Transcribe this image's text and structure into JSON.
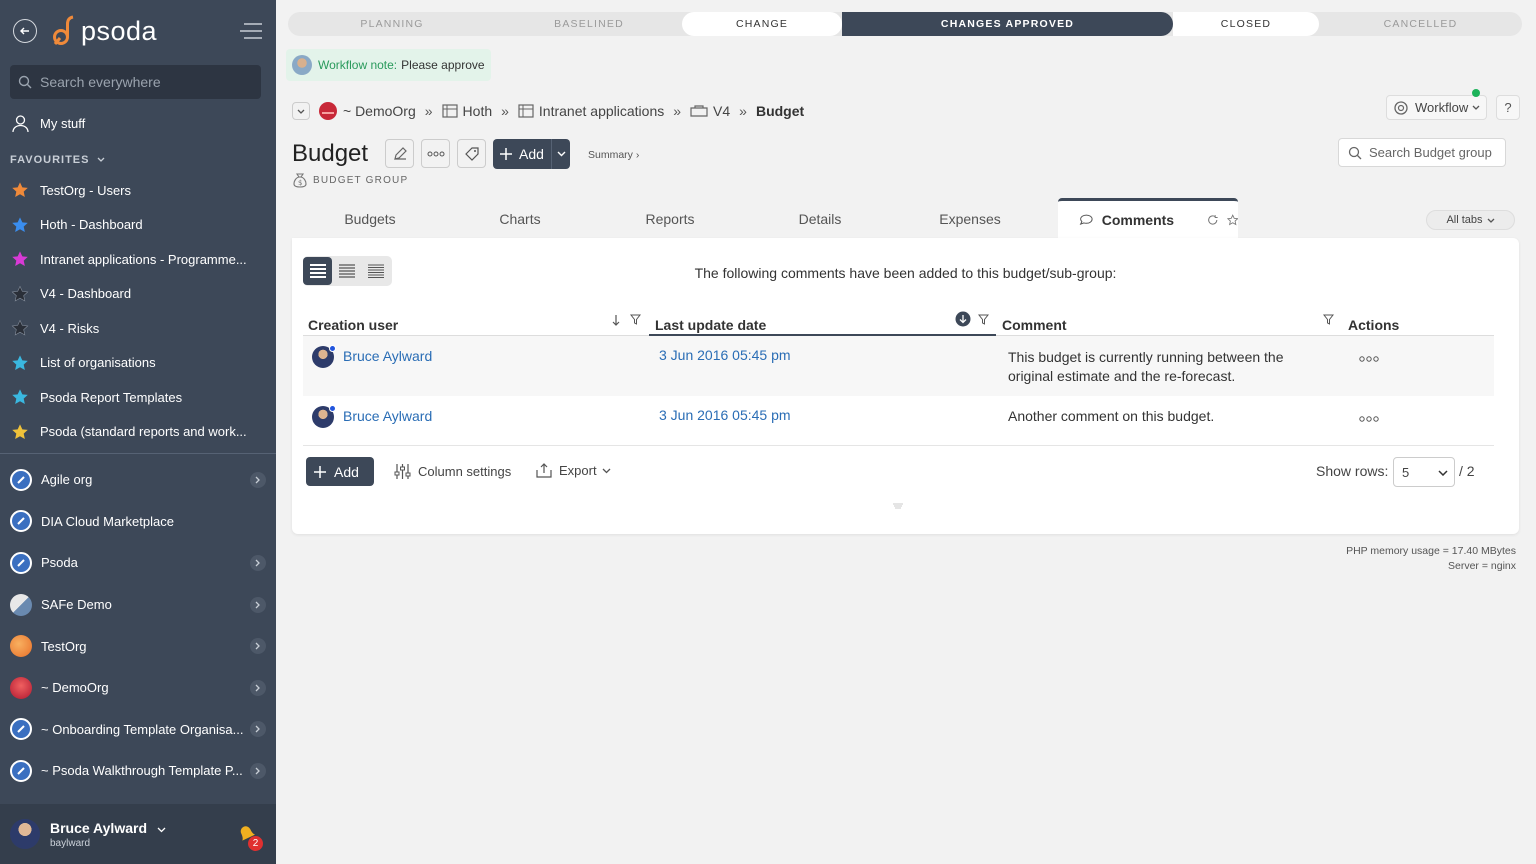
{
  "sidebar": {
    "logo_text": "psoda",
    "search_placeholder": "Search everywhere",
    "my_stuff": "My stuff",
    "favourites_label": "FAVOURITES",
    "favourites": [
      {
        "label": "TestOrg - Users",
        "color": "#f08a3a"
      },
      {
        "label": "Hoth - Dashboard",
        "color": "#3a8ef0"
      },
      {
        "label": "Intranet applications - Programme...",
        "color": "#d93ad6"
      },
      {
        "label": "V4 - Dashboard",
        "color": "#2a2f38"
      },
      {
        "label": "V4 - Risks",
        "color": "#2a2f38"
      },
      {
        "label": "List of organisations",
        "color": "#3ab8e0"
      },
      {
        "label": "Psoda Report Templates",
        "color": "#3ab8e0"
      },
      {
        "label": "Psoda (standard reports and work...",
        "color": "#f0c23a"
      }
    ],
    "orgs": [
      {
        "label": "Agile org",
        "chevron": true
      },
      {
        "label": "DIA Cloud Marketplace",
        "chevron": false
      },
      {
        "label": "Psoda",
        "chevron": true
      },
      {
        "label": "SAFe Demo",
        "chevron": true
      },
      {
        "label": "TestOrg",
        "chevron": true
      },
      {
        "label": "~ DemoOrg",
        "chevron": true
      },
      {
        "label": "~ Onboarding Template Organisa...",
        "chevron": true
      },
      {
        "label": "~ Psoda Walkthrough Template P...",
        "chevron": true
      }
    ],
    "user": {
      "name": "Bruce Aylward",
      "login": "baylward",
      "notifications": "2"
    }
  },
  "stages": [
    "PLANNING",
    "BASELINED",
    "CHANGE",
    "CHANGES APPROVED",
    "CLOSED",
    "CANCELLED"
  ],
  "workflow_note": {
    "label": "Workflow note:",
    "text": "Please approve"
  },
  "breadcrumb": [
    "~ DemoOrg",
    "Hoth",
    "Intranet applications",
    "V4",
    "Budget"
  ],
  "header": {
    "title": "Budget",
    "subtitle": "BUDGET GROUP",
    "add_label": "Add",
    "summary_label": "Summary ›",
    "workflow_label": "Workflow",
    "help_label": "?",
    "search_placeholder": "Search Budget group"
  },
  "tabs": [
    "Budgets",
    "Charts",
    "Reports",
    "Details",
    "Expenses",
    "Comments"
  ],
  "all_tabs_label": "All tabs",
  "table": {
    "intro": "The following comments have been added to this budget/sub-group:",
    "columns": [
      "Creation user",
      "Last update date",
      "Comment",
      "Actions"
    ],
    "rows": [
      {
        "user": "Bruce Aylward",
        "date": "3 Jun 2016 05:45 pm",
        "comment_line1": "This budget is currently running between the",
        "comment_line2": "original estimate and the re-forecast."
      },
      {
        "user": "Bruce Aylward",
        "date": "3 Jun 2016 05:45 pm",
        "comment_line1": "Another comment on this budget.",
        "comment_line2": ""
      }
    ],
    "footer": {
      "add_label": "Add",
      "column_settings": "Column settings",
      "export": "Export",
      "show_rows_label": "Show rows:",
      "rows_value": "5",
      "pages": "/ 2"
    }
  },
  "server_info": {
    "memory": "PHP memory usage = 17.40 MBytes",
    "server": "Server = nginx"
  }
}
